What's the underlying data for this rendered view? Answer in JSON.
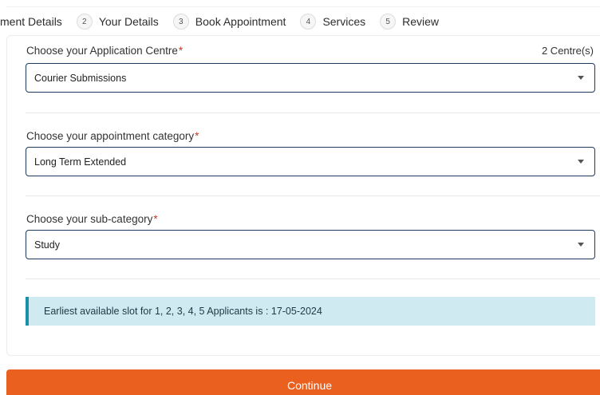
{
  "stepper": {
    "steps": [
      {
        "num": "",
        "label": "ment Details"
      },
      {
        "num": "2",
        "label": "Your Details"
      },
      {
        "num": "3",
        "label": "Book Appointment"
      },
      {
        "num": "4",
        "label": "Services"
      },
      {
        "num": "5",
        "label": "Review"
      }
    ]
  },
  "form": {
    "centre": {
      "label": "Choose your Application Centre",
      "required_mark": "*",
      "count": "2 Centre(s)",
      "value": "Courier Submissions"
    },
    "category": {
      "label": "Choose your appointment category",
      "required_mark": "*",
      "value": "Long Term Extended"
    },
    "subcategory": {
      "label": "Choose your sub-category",
      "required_mark": "*",
      "value": "Study"
    },
    "alert": {
      "text": "Earliest available slot for 1, 2, 3, 4, 5 Applicants is : 17-05-2024"
    }
  },
  "actions": {
    "continue_label": "Continue"
  },
  "colors": {
    "accent": "#e9601f",
    "select_border": "#1e3a5c",
    "alert_bg": "#cfeaf0",
    "alert_border": "#1b8fa8",
    "required": "#c0392b"
  }
}
